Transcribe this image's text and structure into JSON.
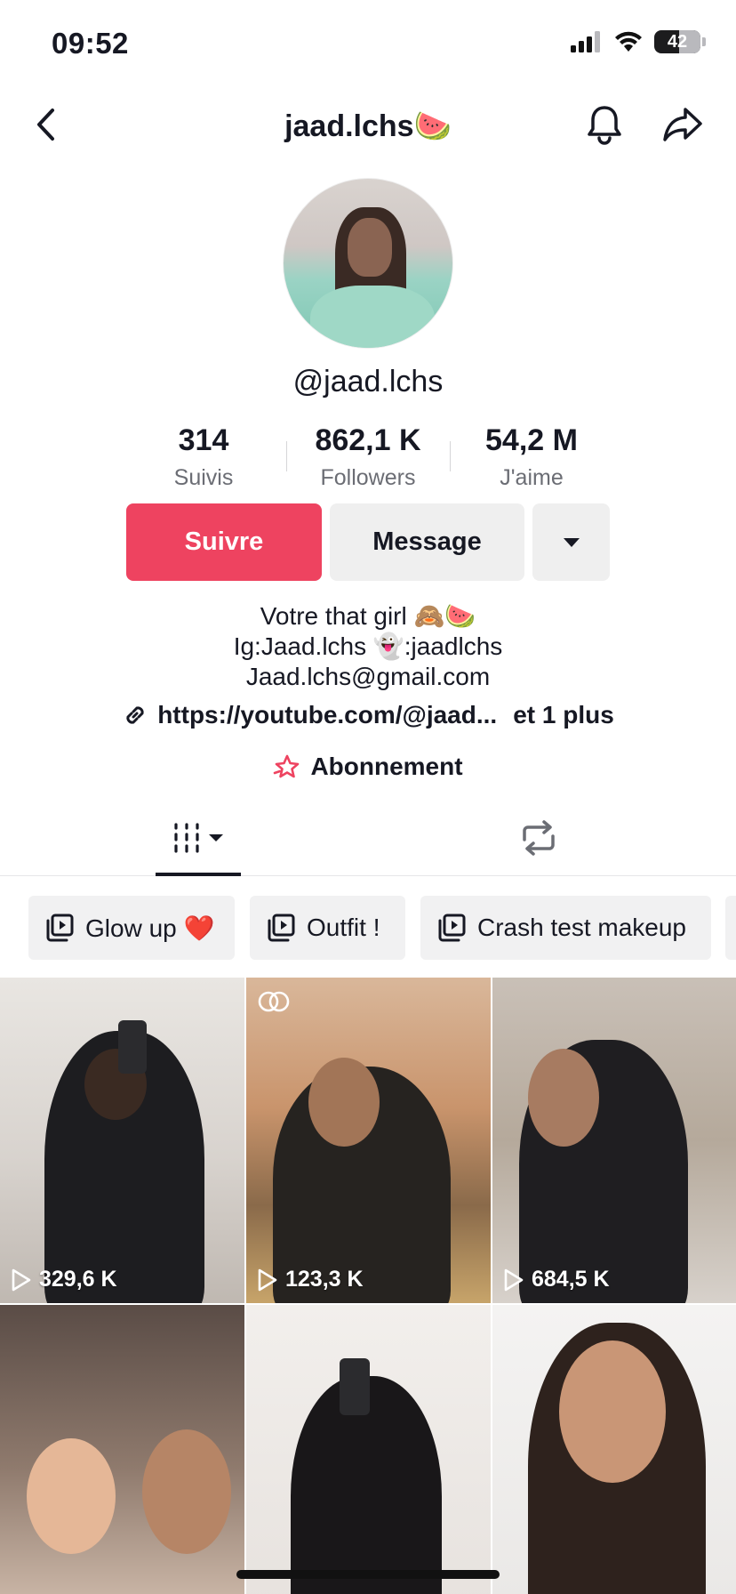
{
  "status_bar": {
    "time": "09:52",
    "battery": "42"
  },
  "nav": {
    "title": "jaad.lchs🍉",
    "back_icon": "chevron-left-icon",
    "bell_icon": "bell-icon",
    "share_icon": "share-arrow-icon"
  },
  "profile": {
    "handle": "@jaad.lchs",
    "stats": [
      {
        "value": "314",
        "label": "Suivis"
      },
      {
        "value": "862,1 K",
        "label": "Followers"
      },
      {
        "value": "54,2 M",
        "label": "J'aime"
      }
    ],
    "buttons": {
      "follow": "Suivre",
      "message": "Message"
    },
    "bio": [
      "Votre that girl 🙈🍉",
      "Ig:Jaad.lchs 👻:jaadlchs",
      "Jaad.lchs@gmail.com"
    ],
    "link": {
      "url": "https://youtube.com/@jaad...",
      "more": "et 1 plus"
    },
    "subscription": "Abonnement"
  },
  "playlists": [
    {
      "label": "Glow up ❤️"
    },
    {
      "label": "Outfit !"
    },
    {
      "label": "Crash test makeup"
    }
  ],
  "videos": [
    {
      "views": "329,6 K"
    },
    {
      "views": "123,3 K"
    },
    {
      "views": "684,5 K"
    },
    {
      "views": ""
    },
    {
      "views": ""
    },
    {
      "views": ""
    }
  ],
  "colors": {
    "accent": "#ee4360",
    "text": "#161823",
    "muted": "#6b6d74"
  }
}
